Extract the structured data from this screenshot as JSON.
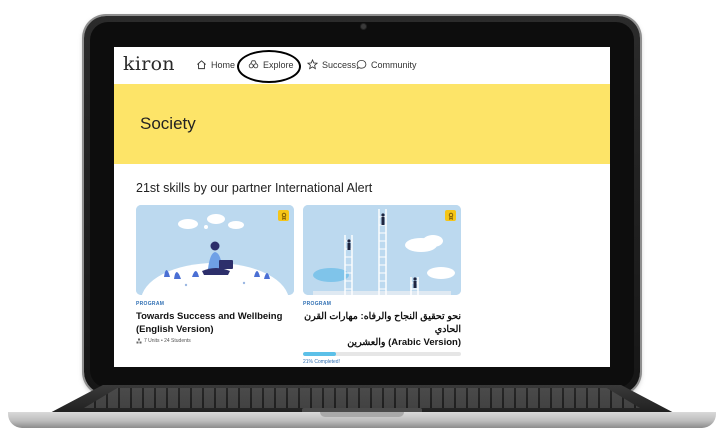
{
  "app": {
    "logo": "kiron"
  },
  "nav": {
    "items": [
      {
        "label": "Home",
        "icon": "home-icon"
      },
      {
        "label": "Explore",
        "icon": "explore-icon"
      },
      {
        "label": "Success",
        "icon": "star-icon"
      },
      {
        "label": "Community",
        "icon": "chat-icon"
      }
    ],
    "highlighted": "Explore"
  },
  "hero": {
    "title": "Society",
    "background_color": "#fde468"
  },
  "section": {
    "title": "21st skills by our partner International Alert"
  },
  "cards": [
    {
      "type": "PROGRAM",
      "title_line1": "Towards Success and Wellbeing",
      "title_line2": "(English Version)",
      "meta": "7 Units • 24 Students",
      "badge_icon": "award-icon"
    },
    {
      "type": "PROGRAM",
      "title_line1": "نحو تحقيق النجاح والرفاه: مهارات القرن الحادي",
      "title_line2": "(Arabic Version) والعشرين",
      "progress": 0.21,
      "progress_label": "21% Completed!",
      "badge_icon": "award-icon"
    }
  ],
  "colors": {
    "accent_blue": "#2f6fb3",
    "progress": "#5cc0e8",
    "badge": "#f5c518"
  }
}
